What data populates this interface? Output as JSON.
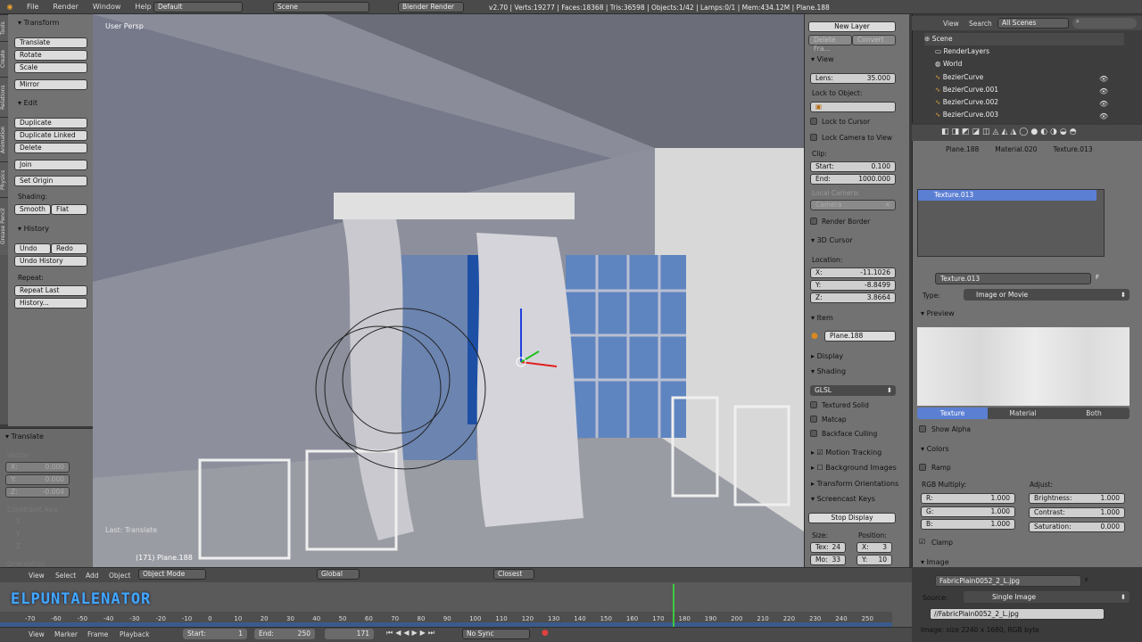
{
  "topbar": {
    "menus": [
      "File",
      "Render",
      "Window",
      "Help"
    ],
    "layout": "Default",
    "scene": "Scene",
    "engine": "Blender Render",
    "stats": "v2.70 | Verts:19277 | Faces:18368 | Tris:36598 | Objects:1/42 | Lamps:0/1 | Mem:434.12M | Plane.188"
  },
  "tool_tabs": [
    "Tools",
    "Create",
    "Relations",
    "Animation",
    "Physics",
    "Grease Pencil"
  ],
  "tools": {
    "transform_header": "Transform",
    "translate": "Translate",
    "rotate": "Rotate",
    "scale": "Scale",
    "mirror": "Mirror",
    "edit_header": "Edit",
    "duplicate": "Duplicate",
    "duplicate_linked": "Duplicate Linked",
    "delete": "Delete",
    "join": "Join",
    "set_origin": "Set Origin",
    "shading_label": "Shading:",
    "smooth": "Smooth",
    "flat": "Flat",
    "history_header": "History",
    "undo": "Undo",
    "redo": "Redo",
    "undo_history": "Undo History",
    "repeat_label": "Repeat:",
    "repeat_last": "Repeat Last",
    "history": "History..."
  },
  "operator": {
    "header": "Translate",
    "vector_label": "Vector",
    "x": "X:",
    "xv": "0.000",
    "y": "Y:",
    "yv": "0.000",
    "z": "Z:",
    "zv": "-0.004",
    "constraint": "Constraint Axis",
    "cx": "X",
    "cy": "Y",
    "cz": "Z",
    "orientation": "Orientation"
  },
  "viewport": {
    "label": "User Persp",
    "last_op": "Last: Translate",
    "object_info": "(171) Plane.188"
  },
  "npanel": {
    "new_layer": "New Layer",
    "delete_frame": "Delete Fra...",
    "convert": "Convert",
    "view_header": "View",
    "lens_label": "Lens:",
    "lens_value": "35.000",
    "lock_to_object": "Lock to Object:",
    "lock_to_cursor": "Lock to Cursor",
    "lock_camera": "Lock Camera to View",
    "clip_label": "Clip:",
    "start_label": "Start:",
    "start_value": "0.100",
    "end_label": "End:",
    "end_value": "1000.000",
    "local_camera": "Local Camera:",
    "camera": "Camera",
    "render_border": "Render Border",
    "cursor_header": "3D Cursor",
    "location_label": "Location:",
    "cx_label": "X:",
    "cx_value": "-11.1026",
    "cy_label": "Y:",
    "cy_value": "-8.8499",
    "cz_label": "Z:",
    "cz_value": "3.8664",
    "item_header": "Item",
    "item_name": "Plane.188",
    "display_header": "Display",
    "shading_header": "Shading",
    "shading_mode": "GLSL",
    "textured_solid": "Textured Solid",
    "matcap": "Matcap",
    "backface": "Backface Culling",
    "motion_tracking": "Motion Tracking",
    "background_images": "Background Images",
    "transform_orientations": "Transform Orientations",
    "screencast": "Screencast Keys",
    "stop_display": "Stop Display",
    "size_label": "Size:",
    "position_label": "Position:",
    "tex_label": "Tex:",
    "tex_value": "24",
    "mo_label": "Mo:",
    "mo_value": "33",
    "px_label": "X:",
    "px_value": "3",
    "py_label": "Y:",
    "py_value": "10"
  },
  "outliner": {
    "menus": [
      "View",
      "Search"
    ],
    "scenes": "All Scenes",
    "items": [
      "Scene",
      "RenderLayers",
      "World",
      "BezierCurve",
      "BezierCurve.001",
      "BezierCurve.002",
      "BezierCurve.003"
    ]
  },
  "properties": {
    "breadcrumb": [
      "Plane.188",
      "Material.020",
      "Texture.013"
    ],
    "slot": "Texture.013",
    "texture_name": "Texture.013",
    "f_label": "F",
    "type_label": "Type:",
    "type_value": "Image or Movie",
    "preview_header": "Preview",
    "tabs": [
      "Texture",
      "Material",
      "Both"
    ],
    "show_alpha": "Show Alpha",
    "colors_header": "Colors",
    "ramp": "Ramp",
    "rgb_label": "RGB Multiply:",
    "adjust_label": "Adjust:",
    "r_label": "R:",
    "r_value": "1.000",
    "g_label": "G:",
    "g_value": "1.000",
    "b_label": "B:",
    "b_value": "1.000",
    "bright_label": "Brightness:",
    "bright_value": "1.000",
    "contrast_label": "Contrast:",
    "contrast_value": "1.000",
    "sat_label": "Saturation:",
    "sat_value": "0.000",
    "clamp": "Clamp",
    "image_header": "Image",
    "image_name": "FabricPlain0052_2_L.jpg",
    "image_f": "F",
    "source_label": "Source:",
    "source_value": "Single Image",
    "filepath": "//FabricPlain0052_2_L.jpg",
    "image_info": "Image: size 2240 x 1680, RGB byte"
  },
  "view3d_header": {
    "menus": [
      "View",
      "Select",
      "Add",
      "Object"
    ],
    "mode": "Object Mode",
    "orientation": "Global",
    "snap": "Closest"
  },
  "timeline": {
    "watermark": "ELPUNTALENATOR",
    "ticks": [
      "-70",
      "-60",
      "-50",
      "-40",
      "-30",
      "-20",
      "-10",
      "0",
      "10",
      "20",
      "30",
      "40",
      "50",
      "60",
      "70",
      "80",
      "90",
      "100",
      "110",
      "120",
      "130",
      "140",
      "150",
      "160",
      "170",
      "180",
      "190",
      "200",
      "210",
      "220",
      "230",
      "240",
      "250"
    ],
    "current_frame": 171,
    "menus": [
      "View",
      "Marker",
      "Frame",
      "Playback"
    ],
    "start_label": "Start:",
    "start_value": "1",
    "end_label": "End:",
    "end_value": "250",
    "frame_value": "171",
    "sync": "No Sync"
  }
}
